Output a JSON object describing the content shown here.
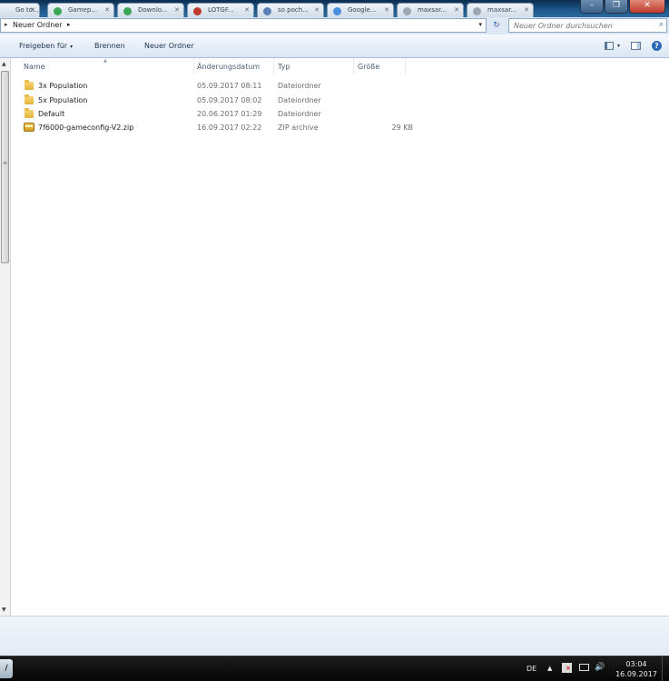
{
  "browser_tabs": [
    {
      "label": "Go to..."
    },
    {
      "label": "Gamep..."
    },
    {
      "label": "Downlo..."
    },
    {
      "label": "LOTGF..."
    },
    {
      "label": "so poch..."
    },
    {
      "label": "Google..."
    },
    {
      "label": "maxsar..."
    },
    {
      "label": "maxsar..."
    }
  ],
  "window_buttons": {
    "minimize": "–",
    "maximize": "❐",
    "close": "✕"
  },
  "address": {
    "nav_arrow": "▸",
    "breadcrumb": "Neuer Ordner",
    "crumb_arrow": "▸",
    "dropdown": "▾",
    "refresh_glyph": "↻"
  },
  "search": {
    "placeholder": "Neuer Ordner durchsuchen",
    "value": ""
  },
  "command_bar": {
    "share_label": "Freigeben für",
    "burn_label": "Brennen",
    "new_folder_label": "Neuer Ordner",
    "caret": "▾",
    "help_glyph": "?"
  },
  "columns": {
    "name": "Name",
    "date": "Änderungsdatum",
    "type": "Typ",
    "size": "Größe"
  },
  "files": [
    {
      "name": "3x Population",
      "date": "05.09.2017 08:11",
      "type": "Dateiordner",
      "size": "",
      "icon": "folder-icon"
    },
    {
      "name": "5x Population",
      "date": "05.09.2017 08:02",
      "type": "Dateiordner",
      "size": "",
      "icon": "folder-icon"
    },
    {
      "name": "Default",
      "date": "20.06.2017 01:29",
      "type": "Dateiordner",
      "size": "",
      "icon": "folder-icon"
    },
    {
      "name": "7f6000-gameconfig-V2.zip",
      "date": "16.09.2017 02:22",
      "type": "ZIP archive",
      "size": "29 KB",
      "icon": "zip-icon"
    }
  ],
  "taskbar": {
    "start_glyph": "/",
    "language": "DE",
    "tray_up": "▲",
    "volume_glyph": "🔊",
    "time": "03:04",
    "date": "16.09.2017"
  },
  "colors": {
    "accent": "#2b68b5",
    "list_bg": "#ffffff",
    "taskbar": "#0b0b0b"
  }
}
